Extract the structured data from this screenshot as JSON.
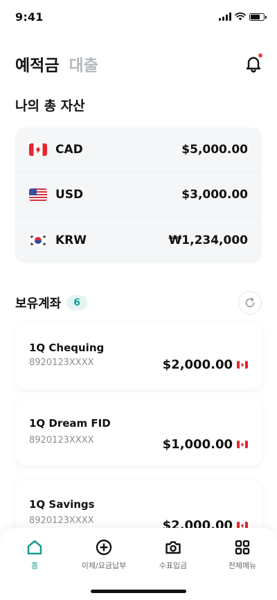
{
  "status_bar": {
    "time": "9:41"
  },
  "header": {
    "tabs": [
      {
        "label": "예적금",
        "active": true
      },
      {
        "label": "대출",
        "active": false
      }
    ],
    "bell_icon": "bell-icon",
    "notification_dot_color": "#f0443c"
  },
  "assets": {
    "title": "나의 총 자산",
    "items": [
      {
        "currency": "CAD",
        "amount": "$5,000.00",
        "flag_icon": "canada-flag-icon"
      },
      {
        "currency": "USD",
        "amount": "$3,000.00",
        "flag_icon": "usa-flag-icon"
      },
      {
        "currency": "KRW",
        "amount": "₩1,234,000",
        "flag_icon": "korea-flag-icon"
      }
    ]
  },
  "accounts": {
    "title": "보유계좌",
    "count": "6",
    "refresh_icon": "refresh-icon",
    "items": [
      {
        "name": "1Q Chequing",
        "number": "8920123XXXX",
        "amount": "$2,000.00",
        "flag_icon": "canada-flag-icon"
      },
      {
        "name": "1Q Dream FID",
        "number": "8920123XXXX",
        "amount": "$1,000.00",
        "flag_icon": "canada-flag-icon"
      },
      {
        "name": "1Q Savings",
        "number": "8920123XXXX",
        "amount": "$2,000.00",
        "flag_icon": "canada-flag-icon"
      }
    ]
  },
  "bottom_nav": {
    "items": [
      {
        "label": "홈",
        "icon": "home-icon",
        "active": true
      },
      {
        "label": "이체/요금납부",
        "icon": "plus-circle-icon",
        "active": false
      },
      {
        "label": "수표입금",
        "icon": "camera-icon",
        "active": false
      },
      {
        "label": "전체메뉴",
        "icon": "grid-icon",
        "active": false
      }
    ]
  },
  "colors": {
    "accent": "#1b9e94",
    "inactive_tab": "#b5b9bd",
    "card_background": "#f4f6f7"
  }
}
